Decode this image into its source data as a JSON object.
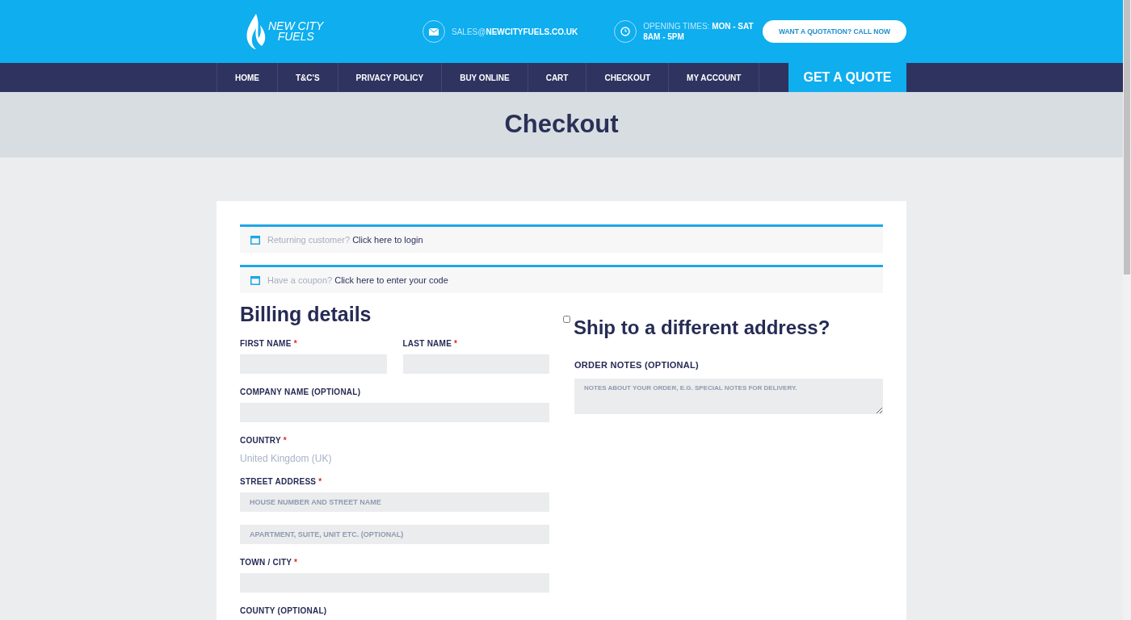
{
  "header": {
    "logo_lines": [
      "NEW CITY",
      "FUELS"
    ],
    "email": "SALES@**NEWCITYFUELS.CO.UK**",
    "hours_line1": "OPENING TIMES: **MON - SAT**",
    "hours_line2": "8AM - 5PM",
    "cta": "WANT A QUOTATION? CALL NOW"
  },
  "nav": {
    "items": [
      "HOME",
      "T&C'S",
      "PRIVACY POLICY",
      "BUY ONLINE",
      "CART",
      "CHECKOUT",
      "MY ACCOUNT"
    ],
    "quote": "GET A QUOTE"
  },
  "page_title": "Checkout",
  "required_mark": "*",
  "notices": [
    {
      "prompt": "Returning customer?",
      "link": "Click here to login"
    },
    {
      "prompt": "Have a coupon?",
      "link": "Click here to enter your code"
    }
  ],
  "billing": {
    "title": "Billing details",
    "fields": [
      {
        "kind": "pair",
        "items": [
          {
            "label": "FIRST NAME",
            "required": true
          },
          {
            "label": "LAST NAME",
            "required": true
          }
        ]
      },
      {
        "kind": "input",
        "label": "COMPANY NAME (OPTIONAL)",
        "required": false
      },
      {
        "kind": "static",
        "label": "COUNTRY",
        "required": true,
        "value": "United Kingdom (UK)"
      },
      {
        "kind": "input",
        "label": "STREET ADDRESS",
        "required": true,
        "placeholders": [
          "HOUSE NUMBER AND STREET NAME",
          "APARTMENT, SUITE, UNIT ETC. (OPTIONAL)"
        ]
      },
      {
        "kind": "input",
        "label": "TOWN / CITY",
        "required": true
      },
      {
        "kind": "label",
        "label": "COUNTY (OPTIONAL)",
        "required": false
      }
    ]
  },
  "shipping": {
    "checked": false,
    "title": "Ship to a different address?",
    "notes_label": "ORDER NOTES (OPTIONAL)",
    "notes_placeholder": "NOTES ABOUT YOUR ORDER, E.G. SPECIAL NOTES FOR DELIVERY."
  }
}
